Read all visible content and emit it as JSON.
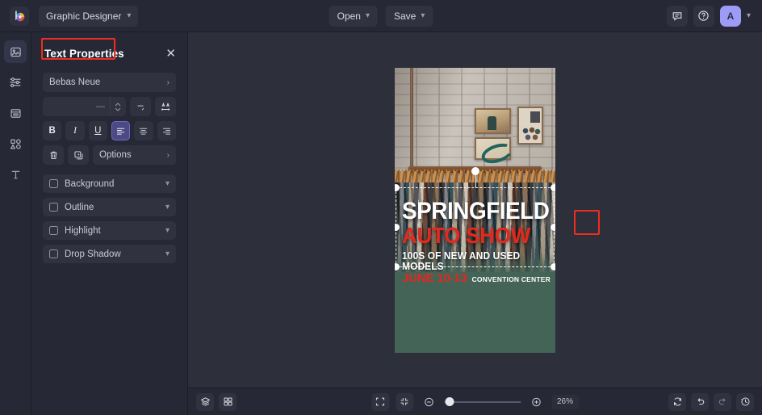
{
  "header": {
    "logo_icon": "color-wheel-logo-icon",
    "project_name": "Graphic Designer",
    "project_chevron": "chevron-down-icon",
    "open_label": "Open",
    "save_label": "Save",
    "comment_icon": "comment-icon",
    "help_icon": "help-circle-icon",
    "avatar_initial": "A",
    "account_chevron": "chevron-down-icon"
  },
  "rail": {
    "items": [
      {
        "name": "media-tool",
        "icon": "image-icon",
        "active": true
      },
      {
        "name": "adjustments-tool",
        "icon": "sliders-icon",
        "active": false
      },
      {
        "name": "layout-tool",
        "icon": "text-block-icon",
        "active": false
      },
      {
        "name": "elements-tool",
        "icon": "shapes-icon",
        "active": false
      },
      {
        "name": "text-tool",
        "icon": "text-t-icon",
        "active": false
      }
    ]
  },
  "panel": {
    "title": "Text Properties",
    "close_icon": "close-x-icon",
    "font_family": "Bebas Neue",
    "font_chevron": "chevron-right-icon",
    "font_size_value": "",
    "font_size_dash": "—",
    "line_height_dash": "—",
    "stepper_up_icon": "chevron-up-icon",
    "stepper_down_icon": "chevron-down-icon",
    "line_height_icon": "line-height-icon",
    "letter_spacing_icon": "letter-spacing-icon",
    "bold_label": "B",
    "italic_label": "I",
    "underline_label": "U",
    "align_left_icon": "align-left-icon",
    "align_center_icon": "align-center-icon",
    "align_right_icon": "align-right-icon",
    "active_alignment": "left",
    "delete_icon": "trash-icon",
    "duplicate_icon": "duplicate-icon",
    "options_label": "Options",
    "options_chevron": "chevron-right-icon",
    "effects": [
      {
        "label": "Background",
        "checked": false,
        "chevron": "chevron-down-icon"
      },
      {
        "label": "Outline",
        "checked": false,
        "chevron": "chevron-down-icon"
      },
      {
        "label": "Highlight",
        "checked": false,
        "chevron": "chevron-down-icon"
      },
      {
        "label": "Drop Shadow",
        "checked": false,
        "chevron": "chevron-down-icon"
      }
    ]
  },
  "poster": {
    "headline": "SPRINGFIELD",
    "subhead": "AUTO SHOW",
    "tagline": "100S OF NEW AND USED MODELS",
    "date": "JUNE 10-13",
    "venue": "CONVENTION CENTER",
    "background_color": "#436456",
    "accent_color": "#e3281d",
    "text_color": "#ffffff"
  },
  "bottom": {
    "layers_icon": "layers-icon",
    "grid_icon": "grid-icon",
    "fit_icon": "expand-frame-icon",
    "fit_content_icon": "collapse-frame-icon",
    "zoom_out_icon": "minus-circle-icon",
    "zoom_in_icon": "plus-circle-icon",
    "zoom_value": "26%",
    "reset_icon": "refresh-icon",
    "undo_icon": "undo-icon",
    "redo_icon": "redo-icon",
    "history_icon": "history-icon"
  },
  "annotations": {
    "title_highlight_color": "#f02d1e",
    "handle_highlight_color": "#f02d1e"
  }
}
